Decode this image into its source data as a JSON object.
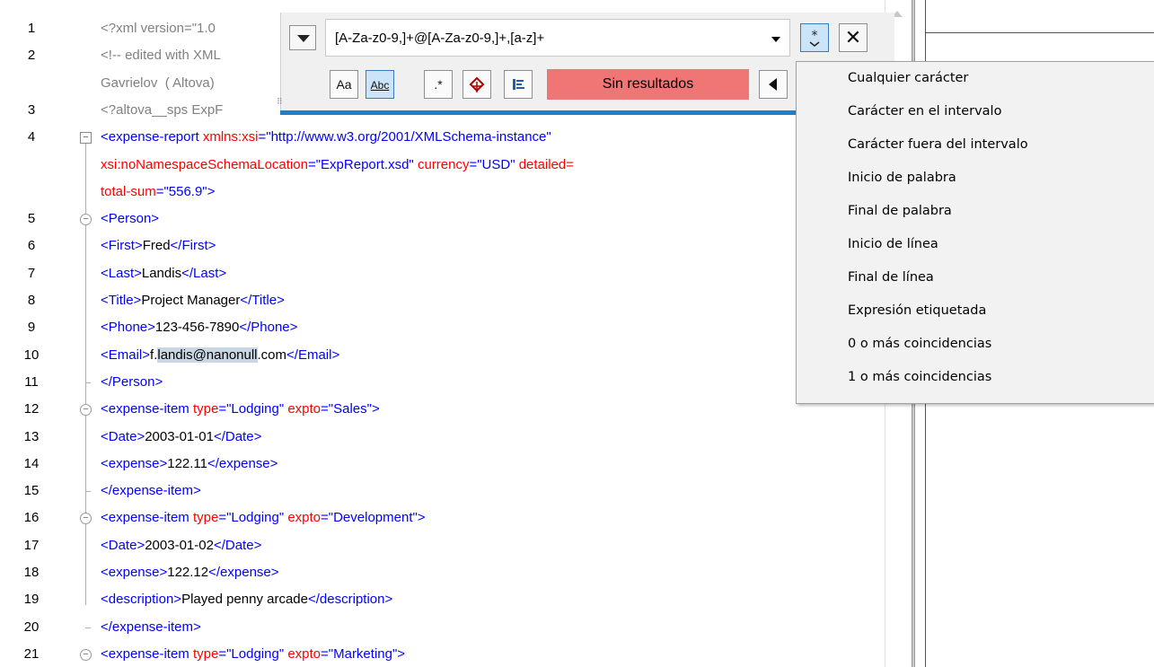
{
  "editor": {
    "lines": [
      {
        "n": "1",
        "segs": [
          [
            "pi",
            "<?xml version=\"1.0"
          ]
        ]
      },
      {
        "n": "2",
        "segs": [
          [
            "com",
            "<!-- edited with XML"
          ]
        ]
      },
      {
        "n": "",
        "segs": [
          [
            "com",
            "Gavrielov  ( Altova)"
          ]
        ]
      },
      {
        "n": "3",
        "segs": [
          [
            "pi",
            "<?altova__sps ExpF"
          ]
        ]
      },
      {
        "n": "4",
        "segs": [
          [
            "t",
            "<expense-report "
          ],
          [
            "a",
            "xmlns:xsi"
          ],
          [
            "t",
            "=\"http://www.w3.org/2001/XMLSchema-instance\""
          ]
        ]
      },
      {
        "n": "",
        "segs": [
          [
            "a",
            "xsi:noNamespaceSchemaLocation"
          ],
          [
            "t",
            "=\"ExpReport.xsd\" "
          ],
          [
            "a",
            "currency"
          ],
          [
            "t",
            "=\"USD\" "
          ],
          [
            "a",
            "detailed="
          ]
        ]
      },
      {
        "n": "",
        "segs": [
          [
            "a",
            "total-sum"
          ],
          [
            "t",
            "=\"556.9\">"
          ]
        ]
      },
      {
        "n": "5",
        "segs": [
          [
            "t",
            "<Person>"
          ]
        ]
      },
      {
        "n": "6",
        "segs": [
          [
            "t",
            "<First>"
          ],
          [
            "txt",
            "Fred"
          ],
          [
            "t",
            "</First>"
          ]
        ]
      },
      {
        "n": "7",
        "segs": [
          [
            "t",
            "<Last>"
          ],
          [
            "txt",
            "Landis"
          ],
          [
            "t",
            "</Last>"
          ]
        ]
      },
      {
        "n": "8",
        "segs": [
          [
            "t",
            "<Title>"
          ],
          [
            "txt",
            "Project Manager"
          ],
          [
            "t",
            "</Title>"
          ]
        ]
      },
      {
        "n": "9",
        "segs": [
          [
            "t",
            "<Phone>"
          ],
          [
            "txt",
            "123-456-7890"
          ],
          [
            "t",
            "</Phone>"
          ]
        ]
      },
      {
        "n": "10",
        "segs": [
          [
            "t",
            "<Email>"
          ],
          [
            "txt",
            "f."
          ],
          [
            "sel",
            "landis@nanonull"
          ],
          [
            "txt",
            ".com"
          ],
          [
            "t",
            "</Email>"
          ]
        ]
      },
      {
        "n": "11",
        "segs": [
          [
            "t",
            "</Person>"
          ]
        ]
      },
      {
        "n": "12",
        "segs": [
          [
            "t",
            "<expense-item "
          ],
          [
            "a",
            "type"
          ],
          [
            "t",
            "=\"Lodging\" "
          ],
          [
            "a",
            "expto"
          ],
          [
            "t",
            "=\"Sales\">"
          ]
        ]
      },
      {
        "n": "13",
        "segs": [
          [
            "t",
            "<Date>"
          ],
          [
            "txt",
            "2003-01-01"
          ],
          [
            "t",
            "</Date>"
          ]
        ]
      },
      {
        "n": "14",
        "segs": [
          [
            "t",
            "<expense>"
          ],
          [
            "txt",
            "122.11"
          ],
          [
            "t",
            "</expense>"
          ]
        ]
      },
      {
        "n": "15",
        "segs": [
          [
            "t",
            "</expense-item>"
          ]
        ]
      },
      {
        "n": "16",
        "segs": [
          [
            "t",
            "<expense-item "
          ],
          [
            "a",
            "type"
          ],
          [
            "t",
            "=\"Lodging\" "
          ],
          [
            "a",
            "expto"
          ],
          [
            "t",
            "=\"Development\">"
          ]
        ]
      },
      {
        "n": "17",
        "segs": [
          [
            "t",
            "<Date>"
          ],
          [
            "txt",
            "2003-01-02"
          ],
          [
            "t",
            "</Date>"
          ]
        ]
      },
      {
        "n": "18",
        "segs": [
          [
            "t",
            "<expense>"
          ],
          [
            "txt",
            "122.12"
          ],
          [
            "t",
            "</expense>"
          ]
        ]
      },
      {
        "n": "19",
        "segs": [
          [
            "t",
            "<description>"
          ],
          [
            "txt",
            "Played penny arcade"
          ],
          [
            "t",
            "</description>"
          ]
        ]
      },
      {
        "n": "20",
        "segs": [
          [
            "t",
            "</expense-item>"
          ]
        ]
      },
      {
        "n": "21",
        "segs": [
          [
            "t",
            "<expense-item "
          ],
          [
            "a",
            "type"
          ],
          [
            "t",
            "=\"Lodging\" "
          ],
          [
            "a",
            "expto"
          ],
          [
            "t",
            "=\"Marketing\">"
          ]
        ]
      }
    ]
  },
  "findbar": {
    "search_value": "[A-Za-z0-9,]+@[A-Za-z0-9,]+,[a-z]+",
    "status_text": "Sin resultados",
    "regex_icon": "regex-builder-icon",
    "close_glyph": "✕",
    "options": [
      {
        "name": "match-case-toggle",
        "glyph": "Aa",
        "active": false
      },
      {
        "name": "whole-word-toggle",
        "glyph": "Abc",
        "active": true
      },
      {
        "name": "regex-toggle",
        "glyph": ".*",
        "active": false
      },
      {
        "name": "find-xml-node-toggle",
        "glyph": "⟳",
        "active": false
      },
      {
        "name": "find-in-selection-toggle",
        "glyph": "≡",
        "active": false
      }
    ]
  },
  "regex_menu": {
    "items": [
      "Cualquier carácter",
      "Carácter en el intervalo",
      "Carácter fuera del intervalo",
      "Inicio de palabra",
      "Final de palabra",
      "Inicio de línea",
      "Final de línea",
      "Expresión etiquetada",
      "0 o más coincidencias",
      "1 o más coincidencias"
    ]
  },
  "colors": {
    "tag": "#0000ff",
    "attribute": "#ff0000",
    "no_results_bg": "#f07575",
    "find_accent": "#1c7fc8"
  }
}
